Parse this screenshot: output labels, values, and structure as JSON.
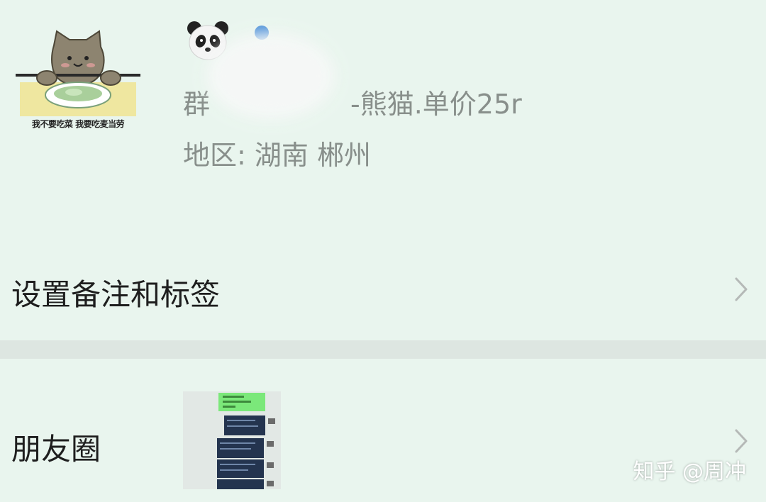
{
  "profile": {
    "avatar_caption": "我不要吃菜 我要吃麦当劳",
    "group_prefix": "群",
    "group_suffix": "-熊猫.单价25r",
    "region_label": "地区:",
    "region_value": "湖南  郴州",
    "nickname_icon": "panda-emoji-icon"
  },
  "menu": {
    "remark_label": "设置备注和标签",
    "moments_label": "朋友圈"
  },
  "watermark": "知乎 @周冲",
  "colors": {
    "background": "#e9f5ee",
    "divider": "#dde6e1",
    "secondary_text": "#888f8b",
    "moments_green": "#7be87a",
    "moments_card": "#24344f"
  }
}
